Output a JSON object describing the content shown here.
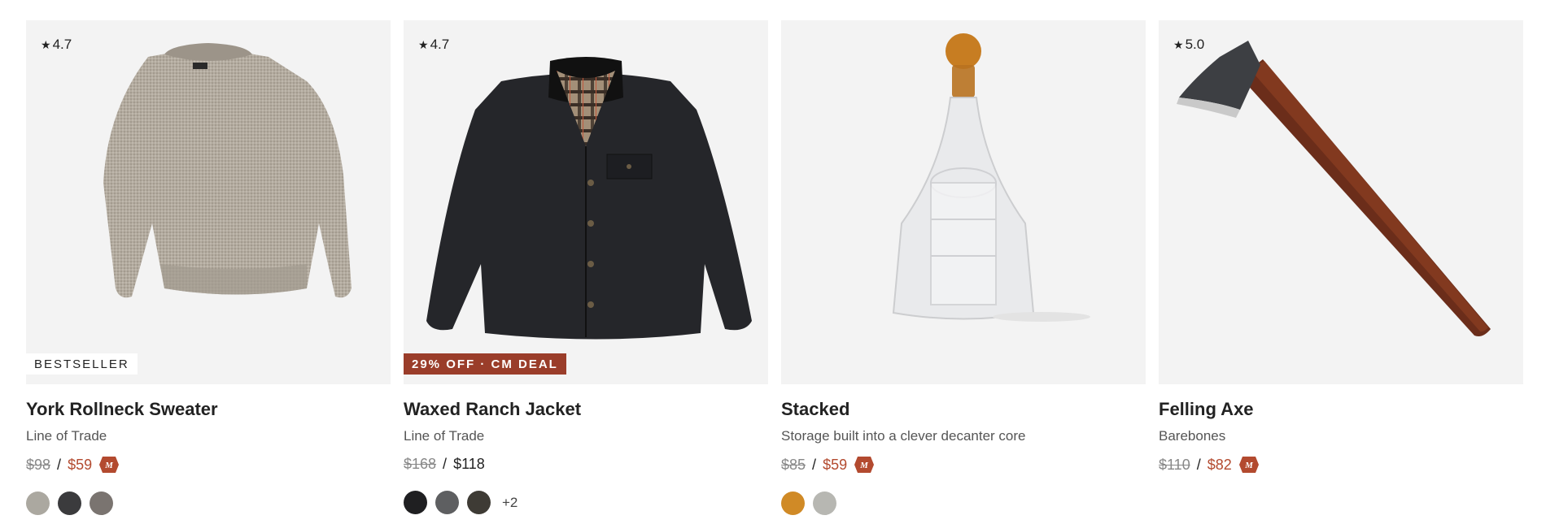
{
  "products": [
    {
      "rating": "4.7",
      "badge": "BESTSELLER",
      "title": "York Rollneck Sweater",
      "subtitle": "Line of Trade",
      "price_original": "$98",
      "price_separator": "/",
      "price_sale": "$59",
      "member_icon": "m-member-icon",
      "swatches": [
        "#aba8a0",
        "#3b3b3d",
        "#7a7470"
      ]
    },
    {
      "rating": "4.7",
      "badge": "29% OFF · CM DEAL",
      "title": "Waxed Ranch Jacket",
      "subtitle": "Line of Trade",
      "price_original": "$168",
      "price_separator": "/",
      "price_sale": "$118",
      "swatches": [
        "#1f1f21",
        "#5e5f61",
        "#3e3b35"
      ],
      "more_colors": "+2"
    },
    {
      "title": "Stacked",
      "subtitle": "Storage built into a clever decanter core",
      "price_original": "$85",
      "price_separator": "/",
      "price_sale": "$59",
      "member_icon": "m-member-icon",
      "swatches": [
        "#d08a26",
        "#b7b7b2"
      ]
    },
    {
      "rating": "5.0",
      "title": "Felling Axe",
      "subtitle": "Barebones",
      "price_original": "$110",
      "price_separator": "/",
      "price_sale": "$82",
      "member_icon": "m-member-icon"
    }
  ],
  "colors": {
    "sale_price": "#b34a2f",
    "deal_badge_bg": "#9a3d2a",
    "card_bg": "#f3f3f3"
  }
}
